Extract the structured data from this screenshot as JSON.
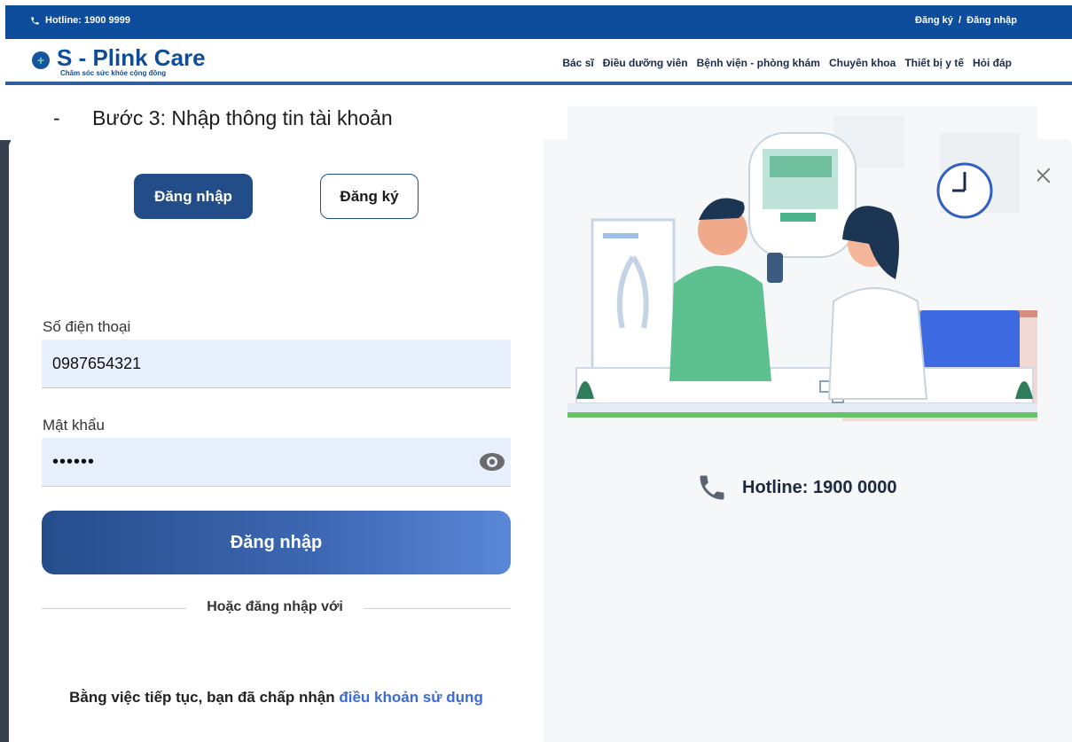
{
  "topbar": {
    "hotline": "Hotline: 1900 9999",
    "register": "Đăng ký",
    "separator": "/",
    "login": "Đăng nhập"
  },
  "brand": {
    "name": "S - Plink Care",
    "tagline": "Chăm sóc sức khỏe cộng đồng"
  },
  "menu": [
    "Bác sĩ",
    "Điều dưỡng viên",
    "Bệnh viện - phòng khám",
    "Chuyên khoa",
    "Thiết bị y tế",
    "Hỏi đáp"
  ],
  "step": {
    "dash": "-",
    "text": "Bước 3: Nhập thông tin tài khoản"
  },
  "modal": {
    "tabs": {
      "login": "Đăng nhập",
      "register": "Đăng ký"
    },
    "phone_label": "Số điện thoại",
    "phone_value": "0987654321",
    "password_label": "Mật khẩu",
    "password_value": "••••••",
    "submit": "Đăng nhập",
    "or_text": "Hoặc đăng nhập với",
    "terms_prefix": "Bằng việc tiếp tục, bạn đã chấp nhận",
    "terms_link": "điều khoản sử dụng",
    "hotline": "Hotline: 1900 0000"
  },
  "colors": {
    "primary": "#234d88",
    "topbar": "#0e4d9b",
    "link": "#3a6bd6",
    "field_bg": "#e8f0fe"
  }
}
